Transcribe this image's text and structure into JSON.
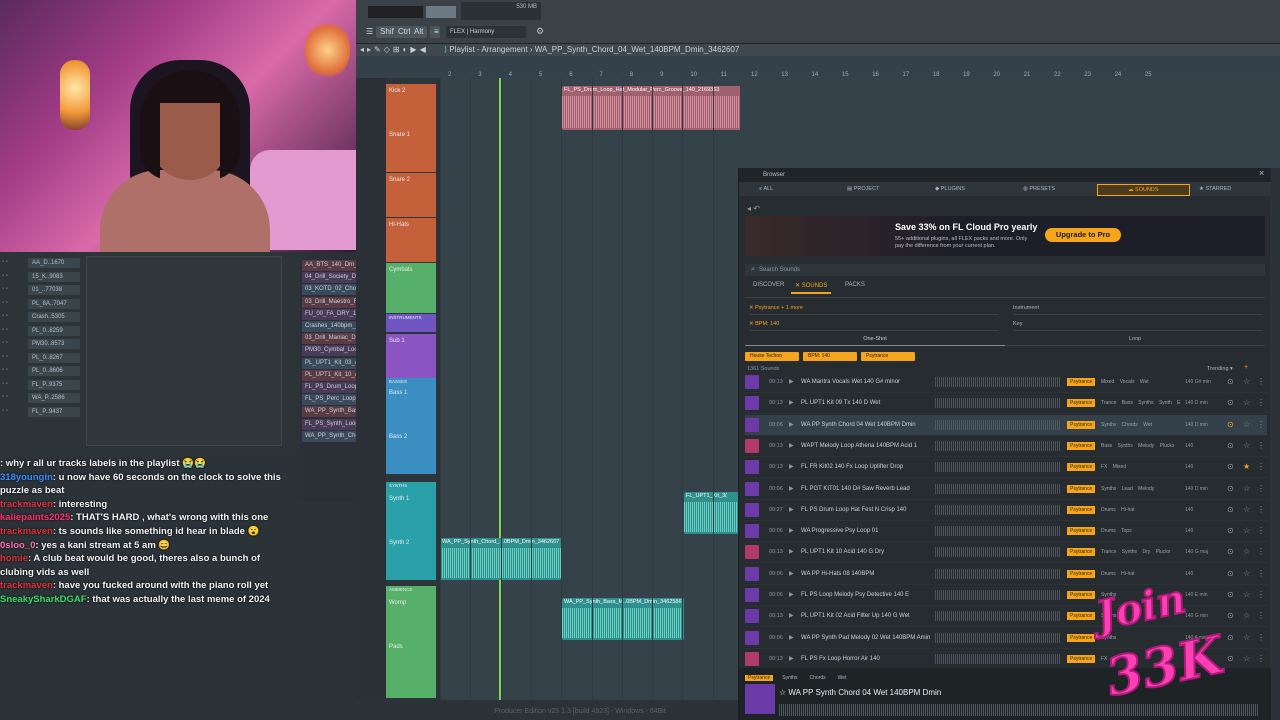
{
  "toolbar": {
    "buttons": [
      "Shift",
      "Ctrl",
      "Alt"
    ],
    "plugin_label": "FLEX | Harmony",
    "cpu": "530 MB"
  },
  "playlist": {
    "breadcrumb": "Playlist - Arrangement",
    "pattern": "WA_PP_Synth_Chord_04_Wet_140BPM_Dmin_3462607",
    "ruler_ticks": [
      "2",
      "3",
      "4",
      "5",
      "6",
      "7",
      "8",
      "9",
      "10",
      "11",
      "12",
      "13",
      "14",
      "15",
      "16",
      "17",
      "18",
      "19",
      "20",
      "21",
      "22",
      "23",
      "24",
      "25"
    ],
    "tracks": [
      {
        "name": "Kick 2",
        "color": "#c4603a"
      },
      {
        "name": "Snare 1",
        "color": "#c4603a"
      },
      {
        "name": "Snare 2",
        "color": "#c4603a"
      },
      {
        "name": "Hi-Hats",
        "color": "#c4603a"
      },
      {
        "name": "Cymbals",
        "color": "#56b06a"
      },
      {
        "name": "INSTRUMENTS",
        "color": "#6e55c2"
      },
      {
        "name": "Sub 1",
        "color": "#8a55c2"
      },
      {
        "name": "BASSES",
        "color": "#3a8ec2"
      },
      {
        "name": "Bass 1",
        "color": "#3a8ec2"
      },
      {
        "name": "Bass 2",
        "color": "#3a8ec2"
      },
      {
        "name": "SYNTHS",
        "color": "#2aa0a8"
      },
      {
        "name": "Synth 1",
        "color": "#2aa0a8"
      },
      {
        "name": "Synth 2",
        "color": "#2aa0a8"
      },
      {
        "name": "AMBIENCE",
        "color": "#56b06a"
      },
      {
        "name": "Womp",
        "color": "#56b06a"
      },
      {
        "name": "Pads",
        "color": "#56b06a"
      }
    ],
    "clips": [
      {
        "title": "FL_PS_Drum_Loop_Hat_Modular_Perc_Groove_140_2169363"
      },
      {
        "title": "WA_PP_Synth_Chord_...0BPM_Dmin_3462607"
      },
      {
        "title": "FL_UPT1_Kit_3("
      },
      {
        "title": "WA_PP_Synth_Bass_M..0BPM_Dmin_3462586"
      }
    ]
  },
  "rack": {
    "items": [
      "AA_BTS_140_Dm_VA..",
      "04_Drill_Society_Dm..",
      "03_KOTD_02_Choir_D..",
      "03_Drill_Maestro_Fm..",
      "FU_00_FA_DRY_140..",
      "Crashes_140bpm_22..",
      "03_Drill_Maniac_Dm..",
      "PM30_Cymbal_Loop..",
      "PL_UPT1_Kit_03_Ac..",
      "PL_UPT1_Kit_10_Ac..",
      "FL_PS_Drum_Loop..",
      "FL_PS_Perc_Loop_M..",
      "WA_PP_Synth_Bass..",
      "FL_PS_Synth_Loop..",
      "WA_PP_Synth_Chord.."
    ]
  },
  "mixer": {
    "rows": [
      "AA_D..1670",
      "15_K..9083",
      "01_..77038",
      "PL_8A..7047",
      "Crash..5305",
      "PL_0..8259",
      "PM30..8573",
      "PL_0..8267",
      "PL_0..8606",
      "FL_P..9375",
      "WA_P..2586",
      "FL_P..9437"
    ]
  },
  "chat": [
    {
      "user": "",
      "color": "#ffffff",
      "text": ": why r all ur tracks labels in the playlist 😭😭"
    },
    {
      "user": "318youngin",
      "color": "#3a8eff",
      "text": ": u now have 60 seconds on the clock to solve this puzzle as beat"
    },
    {
      "user": "trackmaven",
      "color": "#e0303a",
      "text": ": interesting"
    },
    {
      "user": "kaliepaints2025",
      "color": "#ff3070",
      "text": ": THAT'S HARD , what's wrong with this one"
    },
    {
      "user": "trackmaven",
      "color": "#e0303a",
      "text": ": ts sounds like something id hear in blade 😮"
    },
    {
      "user": "0sloo_0",
      "color": "#ff70b0",
      "text": ": yes a kani stream at 5 am 😄"
    },
    {
      "user": "homie",
      "color": "#e0303a",
      "text": ": A club beat would be good, theres also a bunch of clubing vids as well"
    },
    {
      "user": "trackmaven",
      "color": "#e0303a",
      "text": ": have you fucked around with the piano roll yet"
    },
    {
      "user": "SneakySharkDGAF",
      "color": "#36e06a",
      "text": ": that was actually the last meme of 2024"
    }
  ],
  "browser": {
    "title": "Browser",
    "tabs": [
      "ALL",
      "PROJECT",
      "PLUGINS",
      "PRESETS",
      "SOUNDS",
      "STARRED"
    ],
    "promo_title": "Save 33% on FL Cloud Pro yearly",
    "promo_sub": "55+ additional plugins, all FLEX packs and more. Only pay the difference from your current plan.",
    "promo_button": "Upgrade to Pro",
    "search_placeholder": "Search Sounds",
    "subtabs": [
      "DISCOVER",
      "SOUNDS",
      "PACKS"
    ],
    "filters": {
      "genre": "Psytrance + 1 more",
      "bpm": "BPM: 140",
      "instrument": "Instrument",
      "key": "Key",
      "oneshot": "One-Shot",
      "loop": "Loop"
    },
    "pills": [
      "House Techno",
      "BPM: 140",
      "Psytrance"
    ],
    "count": "1361 Sounds",
    "sort": "Trending",
    "sounds": [
      {
        "time": "00:13",
        "name": "WA Mantra Vocals Wet 140 G# minor",
        "tag": "Psytrance",
        "tags": "Mixed Vocals Wet",
        "bpm": "140 G# min"
      },
      {
        "time": "00:13",
        "name": "PL UPT1 Kit 09 Tx 140 D Wet",
        "tag": "Psytrance",
        "tags": "Trance Bass Synths Synth E",
        "bpm": "140 D min"
      },
      {
        "time": "00:06",
        "name": "WA PP Synth Chord 04 Wet 140BPM Dmin",
        "tag": "Psytrance",
        "tags": "Synths Chords Wet",
        "bpm": "140 D min"
      },
      {
        "time": "00:13",
        "name": "WAPT Melody Loop Athena 140BPM Acid 1",
        "tag": "Psytrance",
        "tags": "Bass Synths Melody Plucks",
        "bpm": "140"
      },
      {
        "time": "00:13",
        "name": "FL FR Kit02 140 Fx Loop Uplifter Drop",
        "tag": "Psytrance",
        "tags": "FX Mixed",
        "bpm": "140"
      },
      {
        "time": "00:06",
        "name": "FL PGT KIT01 140 D# Saw Reverb Lead",
        "tag": "Psytrance",
        "tags": "Synths Lead Melody",
        "bpm": "140 D min"
      },
      {
        "time": "00:27",
        "name": "FL PS Drum Loop Hat Fest N Crisp 140",
        "tag": "Psytrance",
        "tags": "Drums Hi-hat",
        "bpm": "140"
      },
      {
        "time": "00:06",
        "name": "WA Progressive Psy Loop 01",
        "tag": "Psytrance",
        "tags": "Drums Tops",
        "bpm": "140"
      },
      {
        "time": "00:13",
        "name": "PL UPT1 Kit 10 Acid 140 G Dry",
        "tag": "Psytrance",
        "tags": "Trance Synths Dry Plucks",
        "bpm": "140 G maj"
      },
      {
        "time": "00:06",
        "name": "WA PP Hi-Hats 08 140BPM",
        "tag": "Psytrance",
        "tags": "Drums Hi-hat",
        "bpm": "140"
      },
      {
        "time": "00:06",
        "name": "FL PS Loop Melody Psy Detective 140 E",
        "tag": "Psytrance",
        "tags": "Synths",
        "bpm": "140 E min"
      },
      {
        "time": "00:13",
        "name": "PL UPT1 Kit 02 Acid Filter Up 140 G Wet",
        "tag": "Psytrance",
        "tags": "Synths",
        "bpm": "140 G min"
      },
      {
        "time": "00:06",
        "name": "WA PP Synth Pad Melody 02 Wet 140BPM Amin",
        "tag": "Psytrance",
        "tags": "Synths",
        "bpm": "140 A min"
      },
      {
        "time": "00:13",
        "name": "FL PS Fx Loop Horror Air 140",
        "tag": "Psytrance",
        "tags": "FX",
        "bpm": "140"
      }
    ],
    "player_tags": [
      "Psytrance",
      "Synths",
      "Chords",
      "Wet"
    ],
    "player_title": "WA PP Synth Chord 04 Wet 140BPM Dmin"
  },
  "status": "Producer Edition v25.1.3 [build 4923] - Windows - 64Bit",
  "badge": {
    "line1": "Join",
    "line2": "33K",
    "color": "#ff3fb4"
  }
}
